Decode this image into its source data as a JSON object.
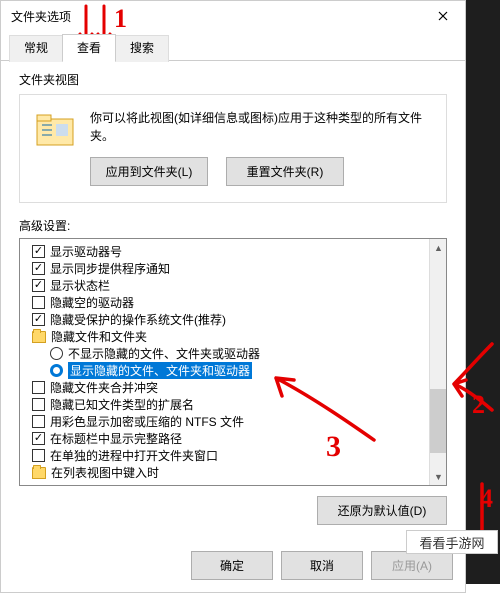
{
  "title": "文件夹选项",
  "tabs": {
    "general": "常规",
    "view": "查看",
    "search": "搜索"
  },
  "folderViews": {
    "label": "文件夹视图",
    "desc": "你可以将此视图(如详细信息或图标)应用于这种类型的所有文件夹。",
    "applyBtn": "应用到文件夹(L)",
    "resetBtn": "重置文件夹(R)"
  },
  "advLabel": "高级设置:",
  "items": {
    "i0": "显示驱动器号",
    "i1": "显示同步提供程序通知",
    "i2": "显示状态栏",
    "i3": "隐藏空的驱动器",
    "i4": "隐藏受保护的操作系统文件(推荐)",
    "i5": "隐藏文件和文件夹",
    "i6": "不显示隐藏的文件、文件夹或驱动器",
    "i7": "显示隐藏的文件、文件夹和驱动器",
    "i8": "隐藏文件夹合并冲突",
    "i9": "隐藏已知文件类型的扩展名",
    "i10": "用彩色显示加密或压缩的 NTFS 文件",
    "i11": "在标题栏中显示完整路径",
    "i12": "在单独的进程中打开文件夹窗口",
    "i13": "在列表视图中键入时"
  },
  "restoreBtn": "还原为默认值(D)",
  "footer": {
    "ok": "确定",
    "cancel": "取消",
    "apply": "应用(A)"
  },
  "ann": {
    "n1": "1",
    "n2": "2",
    "n3": "3",
    "n4": "4"
  },
  "watermark": "看看手游网"
}
